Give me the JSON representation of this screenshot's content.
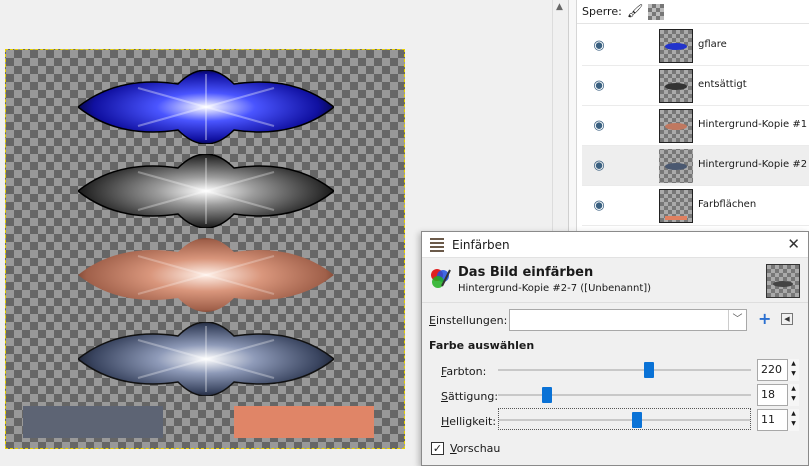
{
  "layers_panel": {
    "lock_label": "Sperre:",
    "layers": [
      {
        "name": "gflare",
        "tint": "#2233cc"
      },
      {
        "name": "entsättigt",
        "tint": "#333333"
      },
      {
        "name": "Hintergrund-Kopie #1",
        "tint": "#c07860"
      },
      {
        "name": "Hintergrund-Kopie #2",
        "tint": "#4a5870"
      },
      {
        "name": "Farbflächen",
        "tint": "#e08060"
      }
    ]
  },
  "canvas": {
    "swatch_left_color": "#5d6474",
    "swatch_right_color": "#e08567"
  },
  "dialog": {
    "title": "Einfärben",
    "header_title": "Das Bild einfärben",
    "header_subtitle": "Hintergrund-Kopie #2-7 ([Unbenannt])",
    "settings_label_first": "E",
    "settings_label_rest": "instellungen:",
    "settings_value": "",
    "section_title": "Farbe auswählen",
    "sliders": [
      {
        "label_first": "F",
        "label_rest": "arbton:",
        "value": "220",
        "fraction": 0.6
      },
      {
        "label_first": "S",
        "label_rest": "ättigung:",
        "value": "18",
        "fraction": 0.18
      },
      {
        "label_first": "H",
        "label_rest": "elligkeit:",
        "value": "11",
        "fraction": 0.55
      }
    ],
    "preview_first": "V",
    "preview_rest": "orschau",
    "preview_checked": "✓"
  }
}
